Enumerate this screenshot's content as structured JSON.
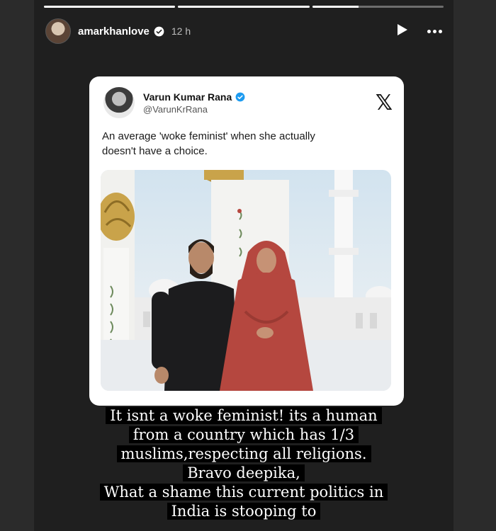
{
  "story": {
    "progress": [
      1,
      1,
      0.35
    ],
    "username": "amarkhanlove",
    "time": "12 h",
    "icons": [
      "verified-badge-icon",
      "play-icon",
      "more-options-icon"
    ]
  },
  "tweet": {
    "name": "Varun Kumar Rana",
    "handle": "@VarunKrRana",
    "text_line1": "An average 'woke feminist' when she actually",
    "text_line2": "doesn't have a choice.",
    "brand_icon": "x-logo-icon"
  },
  "caption": {
    "lines": [
      "It isnt a woke feminist! its a human",
      "from a country which has 1/3",
      "muslims,respecting all religions.",
      "Bravo deepika,",
      "What a shame this current politics in",
      "India is stooping to"
    ]
  },
  "colors": {
    "verified_blue": "#1d9bf0",
    "story_bg": "#1f1f1f",
    "robe_red": "#b5473f"
  }
}
